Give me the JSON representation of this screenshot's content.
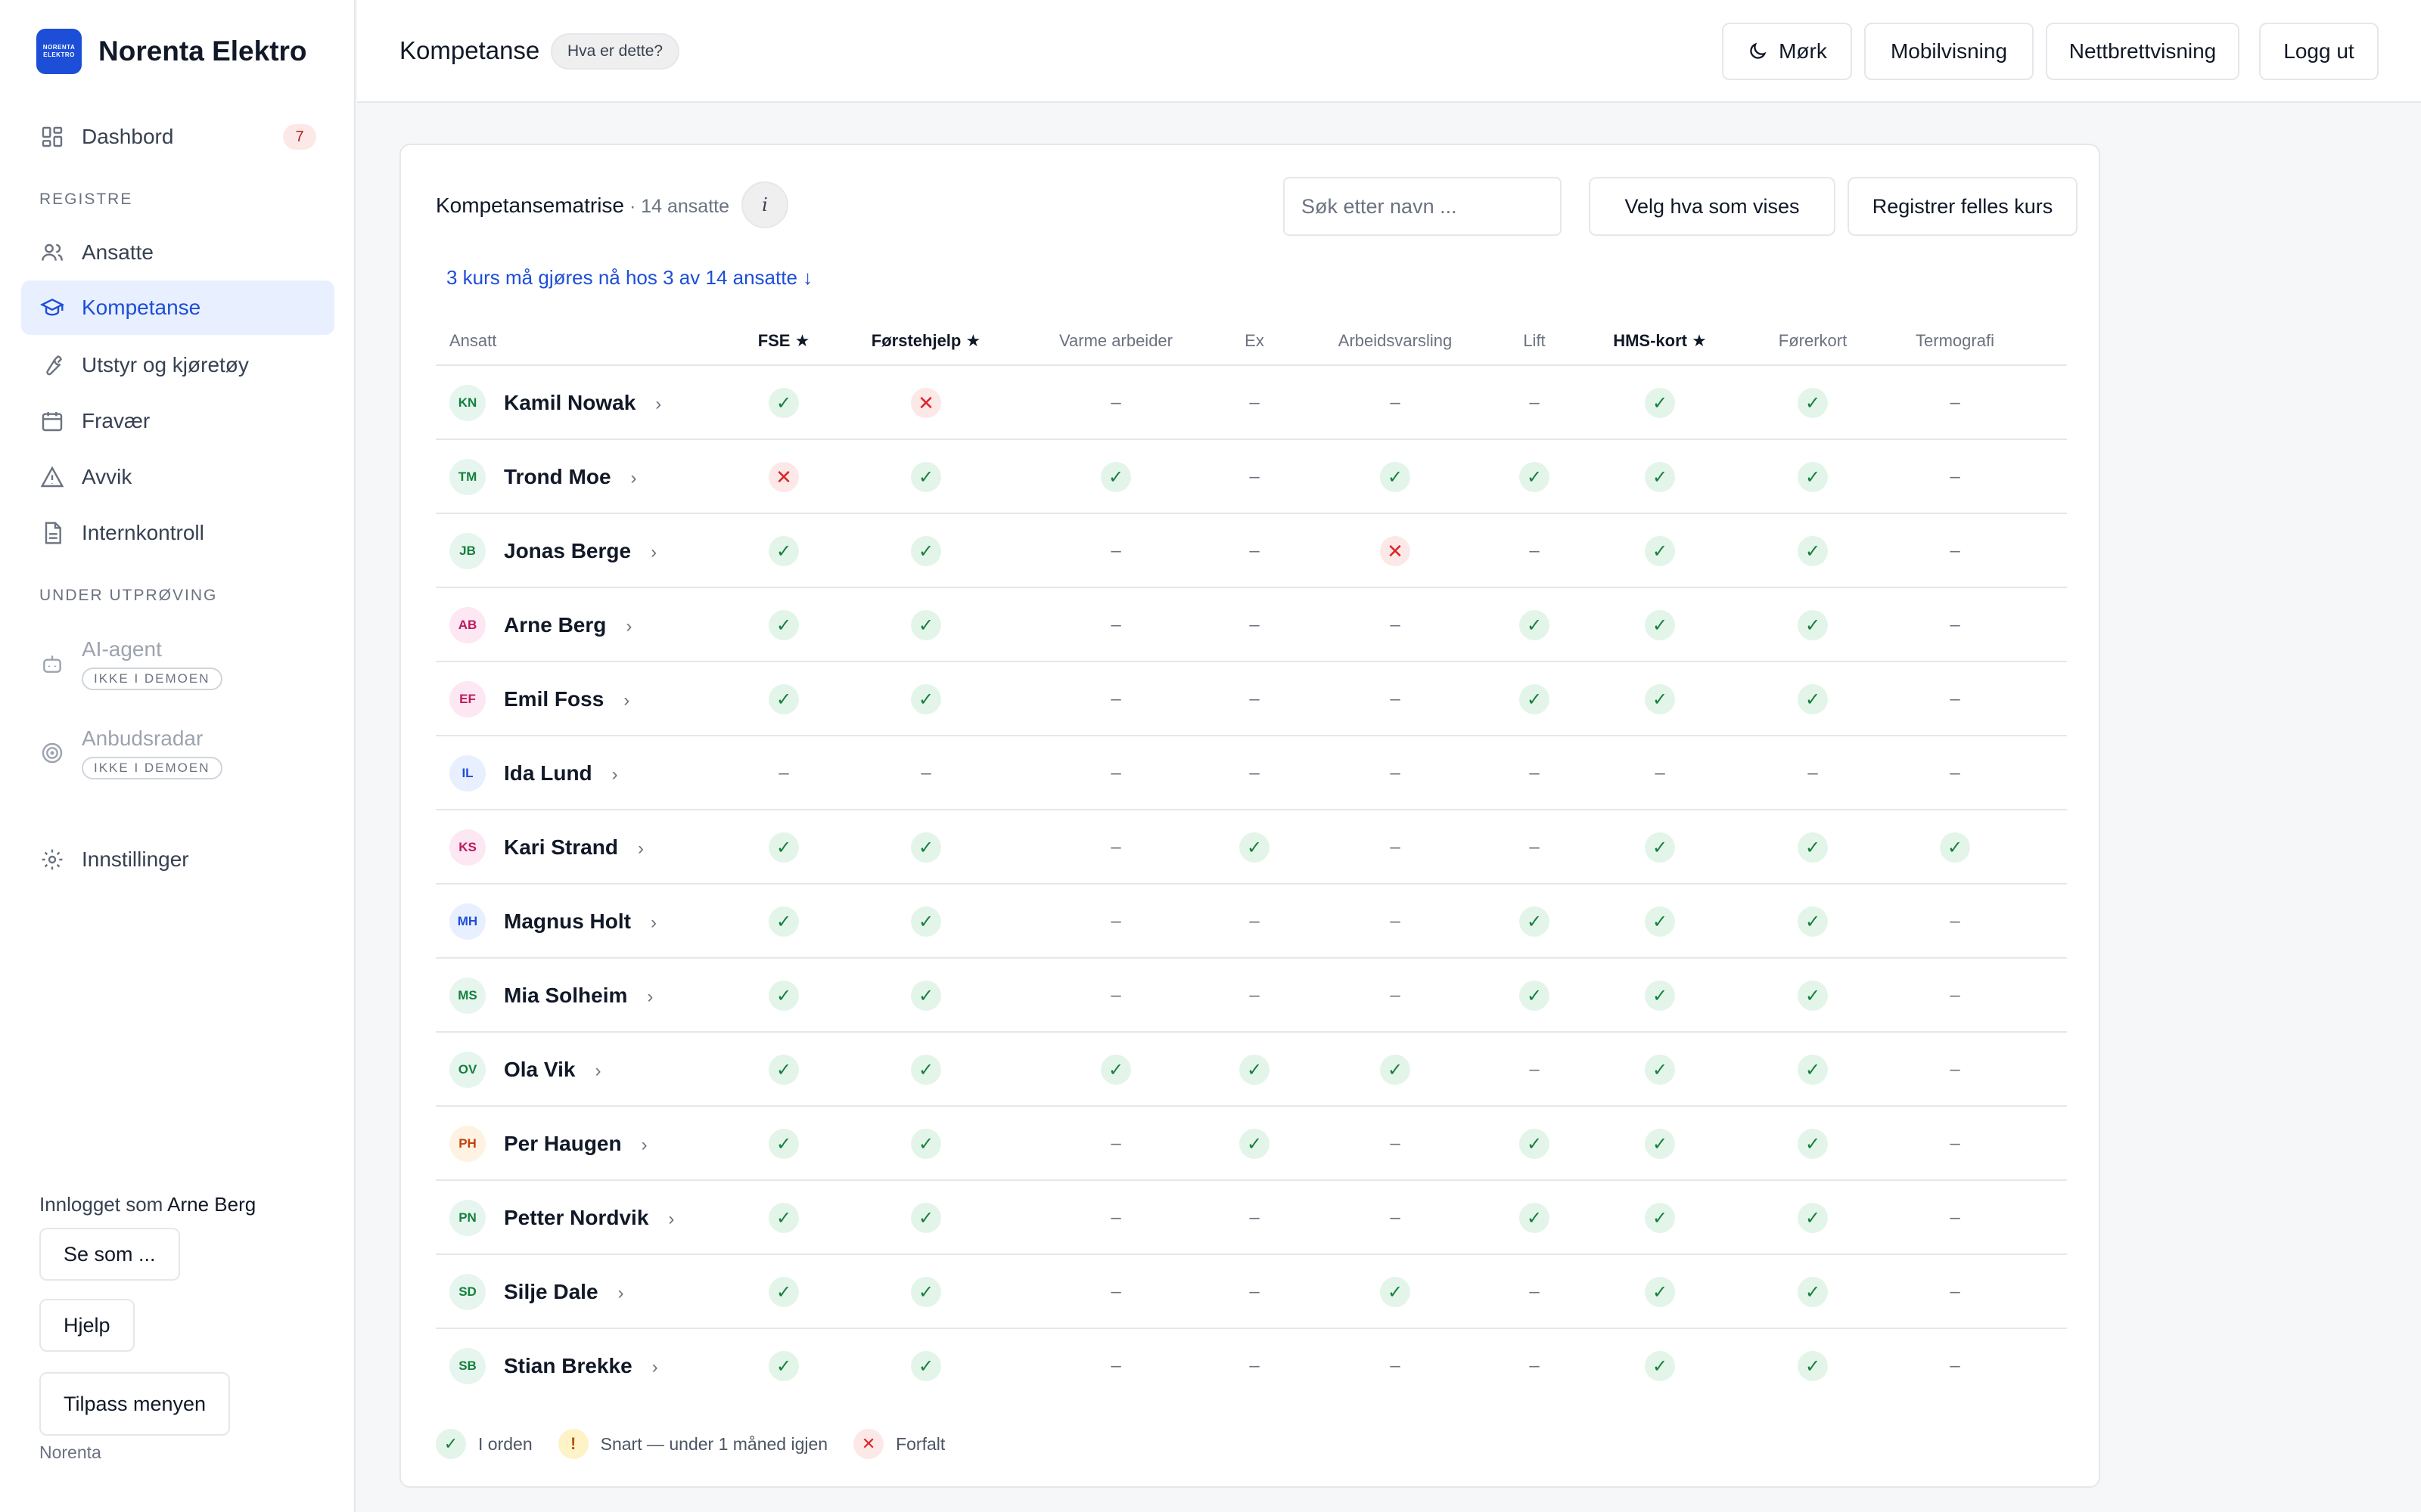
{
  "brand": {
    "logo_line1": "NORENTA",
    "logo_line2": "ELEKTRO",
    "name": "Norenta Elektro"
  },
  "sidebar": {
    "dashboard": {
      "label": "Dashbord",
      "badge": "7"
    },
    "section_registers": "REGISTRE",
    "registers": [
      "Ansatte",
      "Kompetanse",
      "Utstyr og kjøretøy",
      "Fravær",
      "Avvik",
      "Internkontroll"
    ],
    "section_trial": "UNDER UTPRØVING",
    "trial": [
      {
        "label": "AI-agent",
        "pill": "IKKE I DEMOEN"
      },
      {
        "label": "Anbudsradar",
        "pill": "IKKE I DEMOEN"
      }
    ],
    "settings": "Innstillinger",
    "logged_in_prefix": "Innlogget som",
    "logged_in_user": "Arne Berg",
    "buttons": {
      "see_as": "Se som ...",
      "help": "Hjelp",
      "customize": "Tilpass menyen"
    },
    "footer": "Norenta"
  },
  "header": {
    "title": "Kompetanse",
    "what_is_this": "Hva er dette?",
    "dark": "Mørk",
    "mobile": "Mobilvisning",
    "tablet": "Nettbrettvisning",
    "logout": "Logg ut"
  },
  "card": {
    "title": "Kompetansematrise",
    "subtitle": " · 14 ansatte",
    "info": "i",
    "search_placeholder": "Søk etter navn ...",
    "choose_btn": "Velg hva som vises",
    "register_btn": "Registrer felles kurs",
    "alert": "3 kurs må gjøres nå hos 3 av 14 ansatte ↓"
  },
  "table": {
    "employee_header": "Ansatt",
    "columns": [
      {
        "label": "FSE ★",
        "required": true
      },
      {
        "label": "Førstehjelp ★",
        "required": true
      },
      {
        "label": "Varme arbeider",
        "required": false
      },
      {
        "label": "Ex",
        "required": false
      },
      {
        "label": "Arbeidsvarsling",
        "required": false
      },
      {
        "label": "Lift",
        "required": false
      },
      {
        "label": "HMS-kort ★",
        "required": true
      },
      {
        "label": "Førerkort",
        "required": false
      },
      {
        "label": "Termografi",
        "required": false
      }
    ],
    "rows": [
      {
        "initials": "KN",
        "name": "Kamil Nowak",
        "avatar_bg": "#e6f6ee",
        "avatar_fg": "#15803d",
        "status": [
          "ok",
          "bad",
          "none",
          "none",
          "none",
          "none",
          "ok",
          "ok",
          "none"
        ]
      },
      {
        "initials": "TM",
        "name": "Trond Moe",
        "avatar_bg": "#e6f6ee",
        "avatar_fg": "#15803d",
        "status": [
          "bad",
          "ok",
          "ok",
          "none",
          "ok",
          "ok",
          "ok",
          "ok",
          "none"
        ]
      },
      {
        "initials": "JB",
        "name": "Jonas Berge",
        "avatar_bg": "#e6f6ee",
        "avatar_fg": "#15803d",
        "status": [
          "ok",
          "ok",
          "none",
          "none",
          "bad",
          "none",
          "ok",
          "ok",
          "none"
        ]
      },
      {
        "initials": "AB",
        "name": "Arne Berg",
        "avatar_bg": "#fce7f3",
        "avatar_fg": "#be185d",
        "status": [
          "ok",
          "ok",
          "none",
          "none",
          "none",
          "ok",
          "ok",
          "ok",
          "none"
        ]
      },
      {
        "initials": "EF",
        "name": "Emil Foss",
        "avatar_bg": "#fce7f3",
        "avatar_fg": "#be185d",
        "status": [
          "ok",
          "ok",
          "none",
          "none",
          "none",
          "ok",
          "ok",
          "ok",
          "none"
        ]
      },
      {
        "initials": "IL",
        "name": "Ida Lund",
        "avatar_bg": "#e8efff",
        "avatar_fg": "#1d4ed8",
        "status": [
          "none",
          "none",
          "none",
          "none",
          "none",
          "none",
          "none",
          "none",
          "none"
        ]
      },
      {
        "initials": "KS",
        "name": "Kari Strand",
        "avatar_bg": "#fce7f3",
        "avatar_fg": "#be185d",
        "status": [
          "ok",
          "ok",
          "none",
          "ok",
          "none",
          "none",
          "ok",
          "ok",
          "ok"
        ]
      },
      {
        "initials": "MH",
        "name": "Magnus Holt",
        "avatar_bg": "#e8efff",
        "avatar_fg": "#1d4ed8",
        "status": [
          "ok",
          "ok",
          "none",
          "none",
          "none",
          "ok",
          "ok",
          "ok",
          "none"
        ]
      },
      {
        "initials": "MS",
        "name": "Mia Solheim",
        "avatar_bg": "#e6f6ee",
        "avatar_fg": "#15803d",
        "status": [
          "ok",
          "ok",
          "none",
          "none",
          "none",
          "ok",
          "ok",
          "ok",
          "none"
        ]
      },
      {
        "initials": "OV",
        "name": "Ola Vik",
        "avatar_bg": "#e6f6ee",
        "avatar_fg": "#15803d",
        "status": [
          "ok",
          "ok",
          "ok",
          "ok",
          "ok",
          "none",
          "ok",
          "ok",
          "none"
        ]
      },
      {
        "initials": "PH",
        "name": "Per Haugen",
        "avatar_bg": "#fef3e2",
        "avatar_fg": "#c2410c",
        "status": [
          "ok",
          "ok",
          "none",
          "ok",
          "none",
          "ok",
          "ok",
          "ok",
          "none"
        ]
      },
      {
        "initials": "PN",
        "name": "Petter Nordvik",
        "avatar_bg": "#e6f6ee",
        "avatar_fg": "#15803d",
        "status": [
          "ok",
          "ok",
          "none",
          "none",
          "none",
          "ok",
          "ok",
          "ok",
          "none"
        ]
      },
      {
        "initials": "SD",
        "name": "Silje Dale",
        "avatar_bg": "#e6f6ee",
        "avatar_fg": "#15803d",
        "status": [
          "ok",
          "ok",
          "none",
          "none",
          "ok",
          "none",
          "ok",
          "ok",
          "none"
        ]
      },
      {
        "initials": "SB",
        "name": "Stian Brekke",
        "avatar_bg": "#e6f6ee",
        "avatar_fg": "#15803d",
        "status": [
          "ok",
          "ok",
          "none",
          "none",
          "none",
          "none",
          "ok",
          "ok",
          "none"
        ]
      }
    ]
  },
  "legend": {
    "ok": "I orden",
    "soon": "Snart — under 1 måned igjen",
    "expired": "Forfalt"
  },
  "icons": {
    "ok": "✓",
    "bad": "✕",
    "none": "–",
    "soon": "!",
    "chevron": "›"
  },
  "colors": {
    "accent": "#1d4ed8",
    "ok": "#15803d",
    "bad": "#dc2626",
    "warn": "#b45309"
  }
}
